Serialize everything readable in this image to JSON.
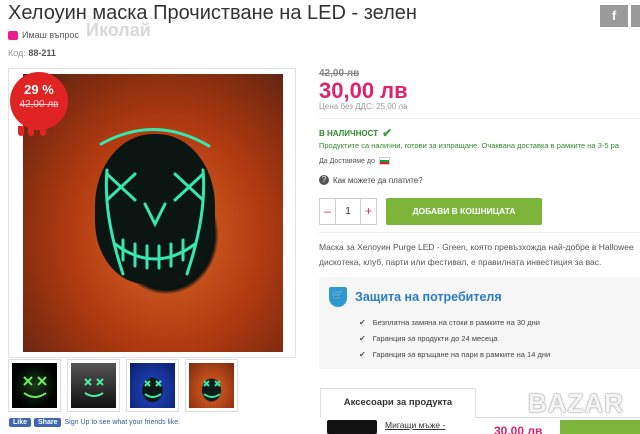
{
  "product": {
    "title": "Хелоуин маска Прочистване на LED - зелен",
    "title_ghost": "Иколай",
    "ask_question": "Имаш въпрос",
    "code_label": "Код:",
    "code_value": "88-211"
  },
  "social": {
    "facebook": "f"
  },
  "badge": {
    "discount": "29 %",
    "old_price": "42,00 лв"
  },
  "pricing": {
    "old_price": "42,00 лв",
    "price": "30,00 лв",
    "price_no_vat": "Цена без ДДС: 25,00 лв"
  },
  "availability": {
    "status": "В НАЛИЧНОСТ",
    "text": "Продуктите са налични, готови за изпращане. Очаквана доставка в рамките на 3-5 ра",
    "deliver_to": "Да Доставяме до",
    "how_pay": "Как можете да платите?"
  },
  "cart": {
    "minus": "–",
    "quantity": "1",
    "plus": "+",
    "add_label": "ДОБАВИ В КОШНИЦАТА"
  },
  "description": {
    "line1": "Маска за Хелоуин Purge LED - Green, която превъзхожда най-добре в Hallowee",
    "line2": "дискотека, клуб, парти или фестивал, е правилната инвестиция за вас."
  },
  "protection": {
    "title": "Защита на потребителя",
    "items": [
      "Безплатна замяна на стоки в рамките на 30 дни",
      "Гаранция за продукти до 24 месеца",
      "Гаранция за връщане на пари в рамките на 14 дни"
    ]
  },
  "accessories": {
    "tab_label": "Аксесоари за продукта",
    "item_name": "Мигащи мъже -",
    "item_price": "30,00 лв"
  },
  "facebook_like": {
    "like": "Like",
    "share": "Share",
    "text": "Sign Up to see what your friends like."
  },
  "watermark": "BAZAR",
  "colors": {
    "price_pink": "#e0226e",
    "discount_red": "#e02323",
    "available_green": "#2e8b2e",
    "button_green": "#7db53a",
    "protection_blue": "#2a7cc0"
  }
}
